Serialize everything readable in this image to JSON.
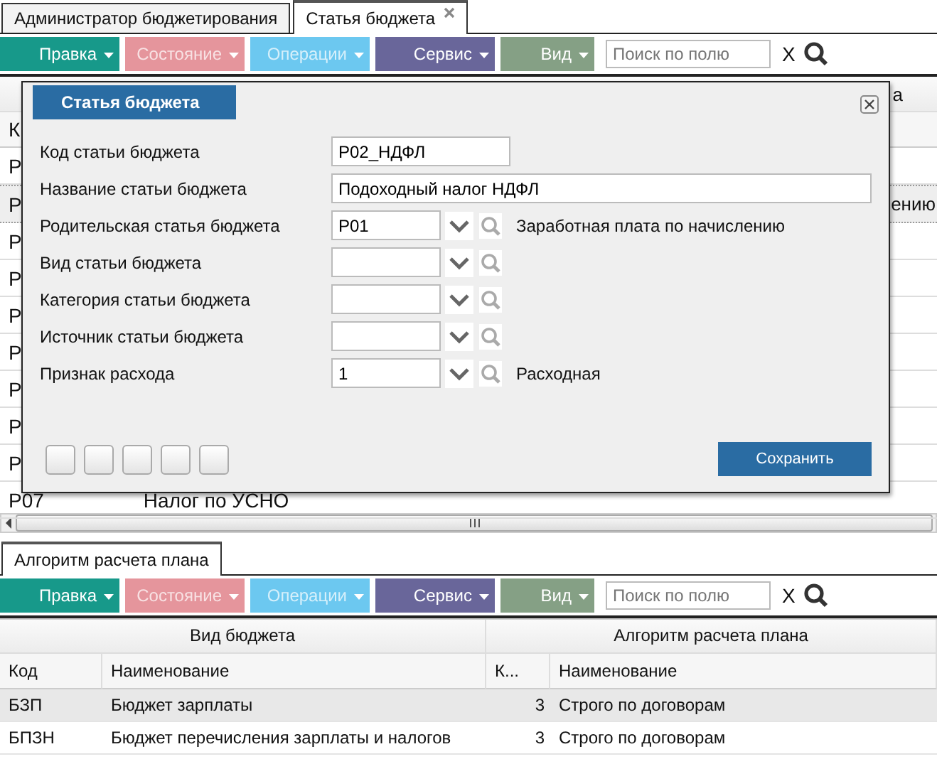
{
  "tabs": [
    {
      "label": "Администратор бюджетирования",
      "selected": false,
      "closable": false
    },
    {
      "label": "Статья бюджета",
      "selected": true,
      "closable": true
    }
  ],
  "toolbar": {
    "menus": [
      {
        "label": "Правка",
        "color": "#17998a",
        "disabled": false
      },
      {
        "label": "Состояние",
        "color": "#e5959c",
        "disabled": true
      },
      {
        "label": "Операции",
        "color": "#6cc8f0",
        "disabled": true
      },
      {
        "label": "Сервис",
        "color": "#69669a",
        "disabled": false
      },
      {
        "label": "Вид",
        "color": "#85a085",
        "disabled": false
      }
    ],
    "search": {
      "placeholder": "Поиск по полю"
    },
    "clear": "X"
  },
  "background_grid": {
    "group_header_right": "а",
    "column_header": "К",
    "rows": [
      {
        "code": "Р",
        "selected": false
      },
      {
        "code": "Р",
        "tail": "ению",
        "selected": true
      },
      {
        "code": "Р",
        "selected": false
      },
      {
        "code": "Р",
        "selected": false
      },
      {
        "code": "Р",
        "selected": false
      },
      {
        "code": "Р",
        "selected": false
      },
      {
        "code": "Р",
        "selected": false
      },
      {
        "code": "Р",
        "selected": false
      },
      {
        "code": "Р",
        "selected": false
      },
      {
        "code": "Р07",
        "name": "Налог по УСНО",
        "selected": false
      }
    ]
  },
  "dialog": {
    "title": "Статья бюджета",
    "fields": [
      {
        "kind": "text",
        "label": "Код статьи бюджета",
        "value": "Р02_НДФЛ",
        "wide": false
      },
      {
        "kind": "text",
        "label": "Название статьи бюджета",
        "value": "Подоходный налог НДФЛ",
        "wide": true
      },
      {
        "kind": "lookup",
        "label": "Родительская статья бюджета",
        "value": "Р01",
        "description": "Заработная плата по начислению"
      },
      {
        "kind": "lookup",
        "label": "Вид статьи бюджета"
      },
      {
        "kind": "lookup",
        "label": "Категория статьи бюджета"
      },
      {
        "kind": "lookup",
        "label": "Источник статьи бюджета"
      },
      {
        "kind": "lookup",
        "label": "Признак расхода",
        "value": "1",
        "description": "Расходная"
      }
    ],
    "save": "Сохранить"
  },
  "bottom": {
    "tab": "Алгоритм расчета плана",
    "toolbar": {
      "menus": [
        {
          "label": "Правка",
          "color": "#17998a",
          "disabled": false
        },
        {
          "label": "Состояние",
          "color": "#e5959c",
          "disabled": true
        },
        {
          "label": "Операции",
          "color": "#6cc8f0",
          "disabled": true
        },
        {
          "label": "Сервис",
          "color": "#69669a",
          "disabled": false
        },
        {
          "label": "Вид",
          "color": "#85a085",
          "disabled": false
        }
      ],
      "search": {
        "placeholder": "Поиск по полю"
      },
      "clear": "X"
    },
    "groups": [
      "Вид бюджета",
      "Алгоритм расчета плана"
    ],
    "columns": [
      "Код",
      "Наименование",
      "К...",
      "Наименование"
    ],
    "rows": [
      {
        "cells": [
          "БЗП",
          "Бюджет зарплаты",
          "3",
          "Строго по договорам"
        ],
        "selected": true
      },
      {
        "cells": [
          "БПЗН",
          "Бюджет перечисления зарплаты и налогов",
          "3",
          "Строго по договорам"
        ],
        "selected": false
      }
    ]
  }
}
